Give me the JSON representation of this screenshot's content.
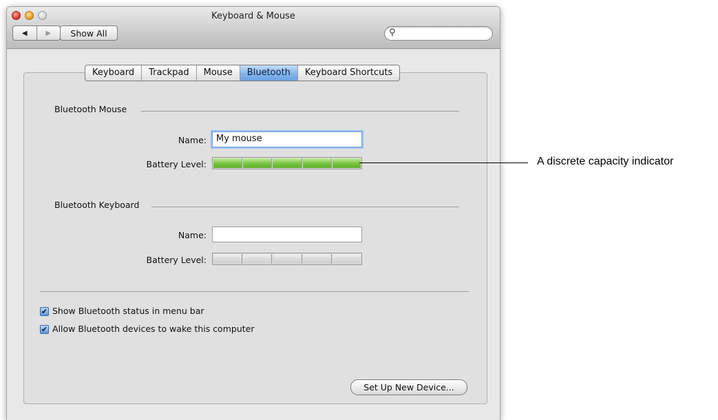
{
  "window": {
    "title": "Keyboard & Mouse"
  },
  "toolbar": {
    "back": "◀",
    "forward": "▶",
    "show_all": "Show All",
    "search_placeholder": ""
  },
  "tabs": [
    {
      "label": "Keyboard",
      "active": false
    },
    {
      "label": "Trackpad",
      "active": false
    },
    {
      "label": "Mouse",
      "active": false
    },
    {
      "label": "Bluetooth",
      "active": true
    },
    {
      "label": "Keyboard Shortcuts",
      "active": false
    }
  ],
  "mouse": {
    "heading": "Bluetooth Mouse",
    "name_label": "Name:",
    "name_value": "My mouse",
    "battery_label": "Battery Level:",
    "battery_level": "5/5"
  },
  "keyboard": {
    "heading": "Bluetooth Keyboard",
    "name_label": "Name:",
    "name_value": "",
    "battery_label": "Battery Level:",
    "battery_level": "0/5"
  },
  "options": {
    "show_status": "Show Bluetooth status in menu bar",
    "allow_wake": "Allow Bluetooth devices to wake this computer"
  },
  "buttons": {
    "setup": "Set Up New Device..."
  },
  "callout": {
    "text": "A discrete capacity indicator"
  },
  "colors": {
    "accent": "#84b4ea",
    "battery_fill": "#7cc645"
  }
}
